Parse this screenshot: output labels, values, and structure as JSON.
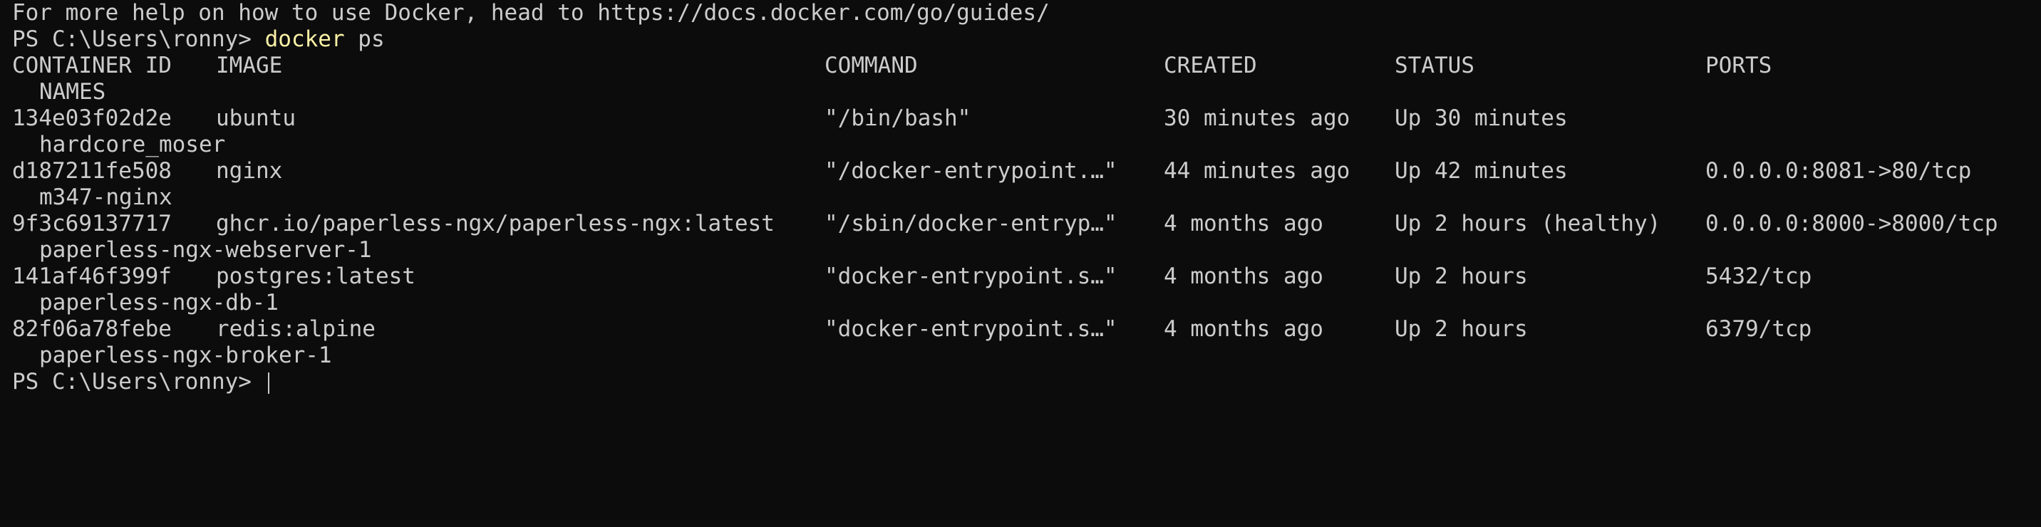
{
  "terminal": {
    "help_line": "For more help on how to use Docker, head to https://docs.docker.com/go/guides/",
    "prompt": "PS C:\\Users\\ronny>",
    "command_name": "docker",
    "command_args": "ps",
    "headers": {
      "container_id": "CONTAINER ID",
      "image": "IMAGE",
      "command": "COMMAND",
      "created": "CREATED",
      "status": "STATUS",
      "ports": "PORTS",
      "names": "NAMES"
    },
    "rows": [
      {
        "container_id": "134e03f02d2e",
        "image": "ubuntu",
        "command": "\"/bin/bash\"",
        "created": "30 minutes ago",
        "status": "Up 30 minutes",
        "ports": "",
        "names": "hardcore_moser"
      },
      {
        "container_id": "d187211fe508",
        "image": "nginx",
        "command": "\"/docker-entrypoint.…\"",
        "created": "44 minutes ago",
        "status": "Up 42 minutes",
        "ports": "0.0.0.0:8081->80/tcp",
        "names": "m347-nginx"
      },
      {
        "container_id": "9f3c69137717",
        "image": "ghcr.io/paperless-ngx/paperless-ngx:latest",
        "command": "\"/sbin/docker-entryp…\"",
        "created": "4 months ago",
        "status": "Up 2 hours (healthy)",
        "ports": "0.0.0.0:8000->8000/tcp",
        "names": "paperless-ngx-webserver-1"
      },
      {
        "container_id": "141af46f399f",
        "image": "postgres:latest",
        "command": "\"docker-entrypoint.s…\"",
        "created": "4 months ago",
        "status": "Up 2 hours",
        "ports": "5432/tcp",
        "names": "paperless-ngx-db-1"
      },
      {
        "container_id": "82f06a78febe",
        "image": "redis:alpine",
        "command": "\"docker-entrypoint.s…\"",
        "created": "4 months ago",
        "status": "Up 2 hours",
        "ports": "6379/tcp",
        "names": "paperless-ngx-broker-1"
      }
    ]
  },
  "colors": {
    "background": "#0c0c0c",
    "foreground": "#cccccc",
    "command_highlight": "#f9f1a5"
  }
}
